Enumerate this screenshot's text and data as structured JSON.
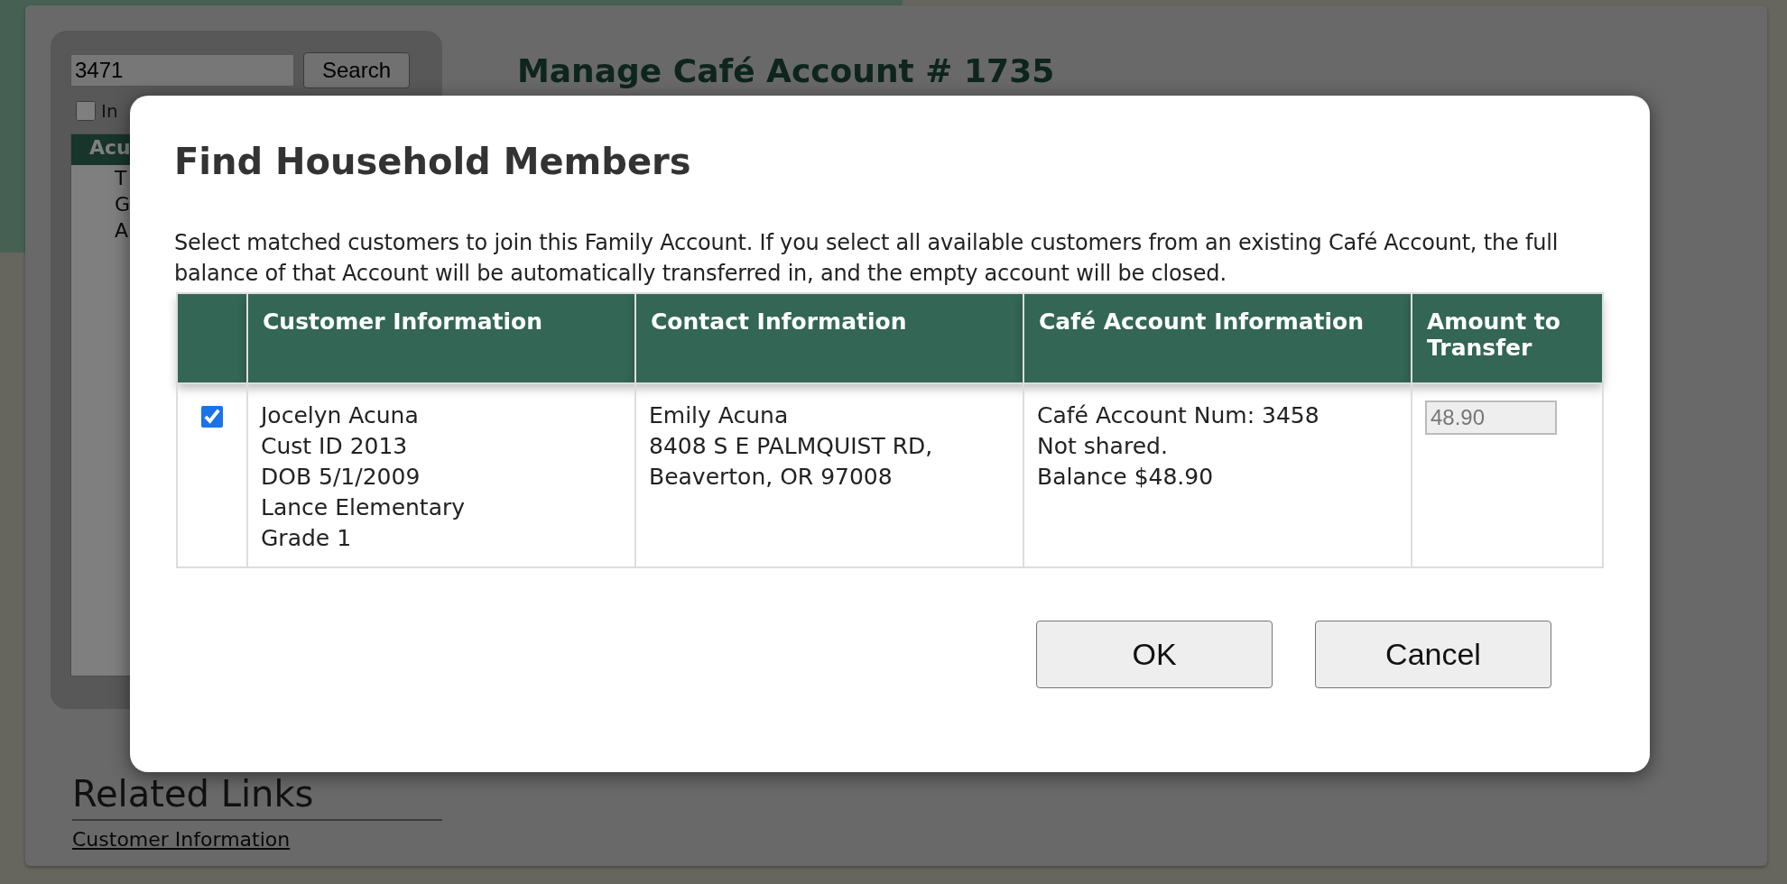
{
  "background": {
    "search": {
      "value": "3471",
      "button": "Search"
    },
    "include_checkbox": {
      "label": "In",
      "checked": false
    },
    "account_list": {
      "header": "Acu",
      "items": [
        "T",
        "G",
        "A"
      ]
    },
    "heading": "Manage Café Account # 1735",
    "related_links": {
      "title": "Related Links",
      "links": [
        "Customer Information"
      ]
    }
  },
  "dialog": {
    "title": "Find Household Members",
    "description": "Select matched customers to join this Family Account. If you select all available customers from an existing Café Account, the full balance of that Account will be automatically transferred in, and the empty account will be closed.",
    "table": {
      "columns": [
        "Customer Information",
        "Contact Information",
        "Café Account Information",
        "Amount to Transfer"
      ],
      "rows": [
        {
          "checked": true,
          "customer": [
            "Jocelyn Acuna",
            "Cust ID 2013",
            "DOB 5/1/2009",
            "Lance Elementary",
            "Grade 1"
          ],
          "contact": [
            "Emily Acuna",
            "8408 S E PALMQUIST RD,",
            "Beaverton, OR 97008"
          ],
          "cafe_account": [
            "Café Account Num: 3458",
            "Not shared.",
            "Balance $48.90"
          ],
          "amount": "48.90",
          "amount_disabled": true
        }
      ]
    },
    "buttons": [
      "OK",
      "Cancel"
    ]
  }
}
